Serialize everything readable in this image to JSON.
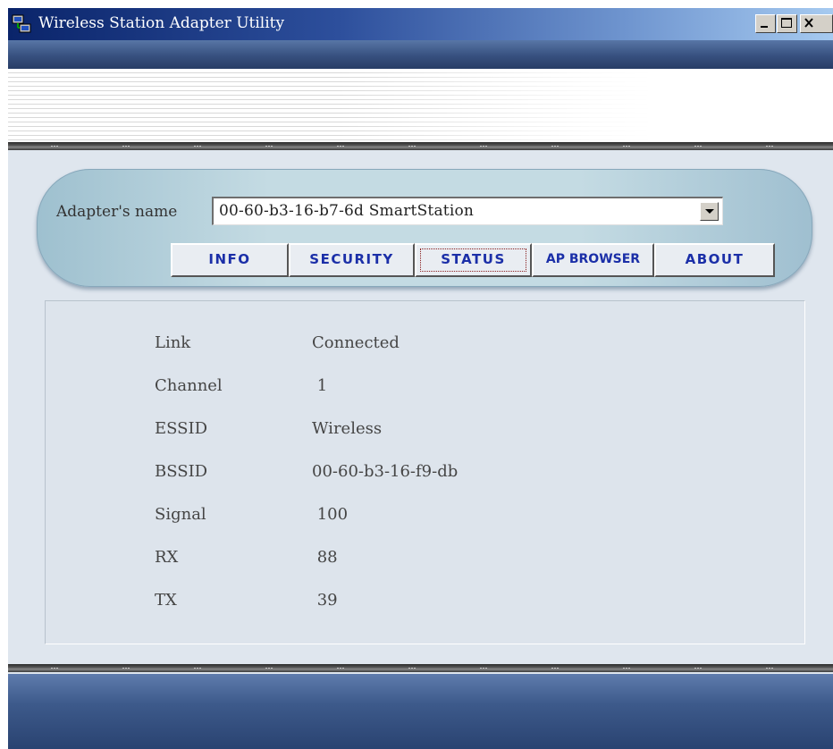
{
  "window": {
    "title": "Wireless Station Adapter Utility",
    "controls": {
      "minimize": "minimize",
      "maximize": "maximize",
      "close": "close"
    }
  },
  "adapter": {
    "label": "Adapter's name",
    "selected": "00-60-b3-16-b7-6d  SmartStation"
  },
  "tabs": [
    {
      "label": "INFO",
      "active": false
    },
    {
      "label": "SECURITY",
      "active": false
    },
    {
      "label": "STATUS",
      "active": true
    },
    {
      "label": "AP BROWSER",
      "active": false
    },
    {
      "label": "ABOUT",
      "active": false
    }
  ],
  "status": {
    "rows": [
      {
        "label": "Link",
        "value": "Connected"
      },
      {
        "label": "Channel",
        "value": " 1"
      },
      {
        "label": "ESSID",
        "value": "Wireless"
      },
      {
        "label": "BSSID",
        "value": "00-60-b3-16-f9-db"
      },
      {
        "label": "Signal",
        "value": " 100"
      },
      {
        "label": "RX",
        "value": " 88"
      },
      {
        "label": "TX",
        "value": " 39"
      }
    ]
  },
  "colors": {
    "titlebar": "#0a246a",
    "tab_text": "#1b2fa8",
    "panel": "#dde4ec"
  }
}
